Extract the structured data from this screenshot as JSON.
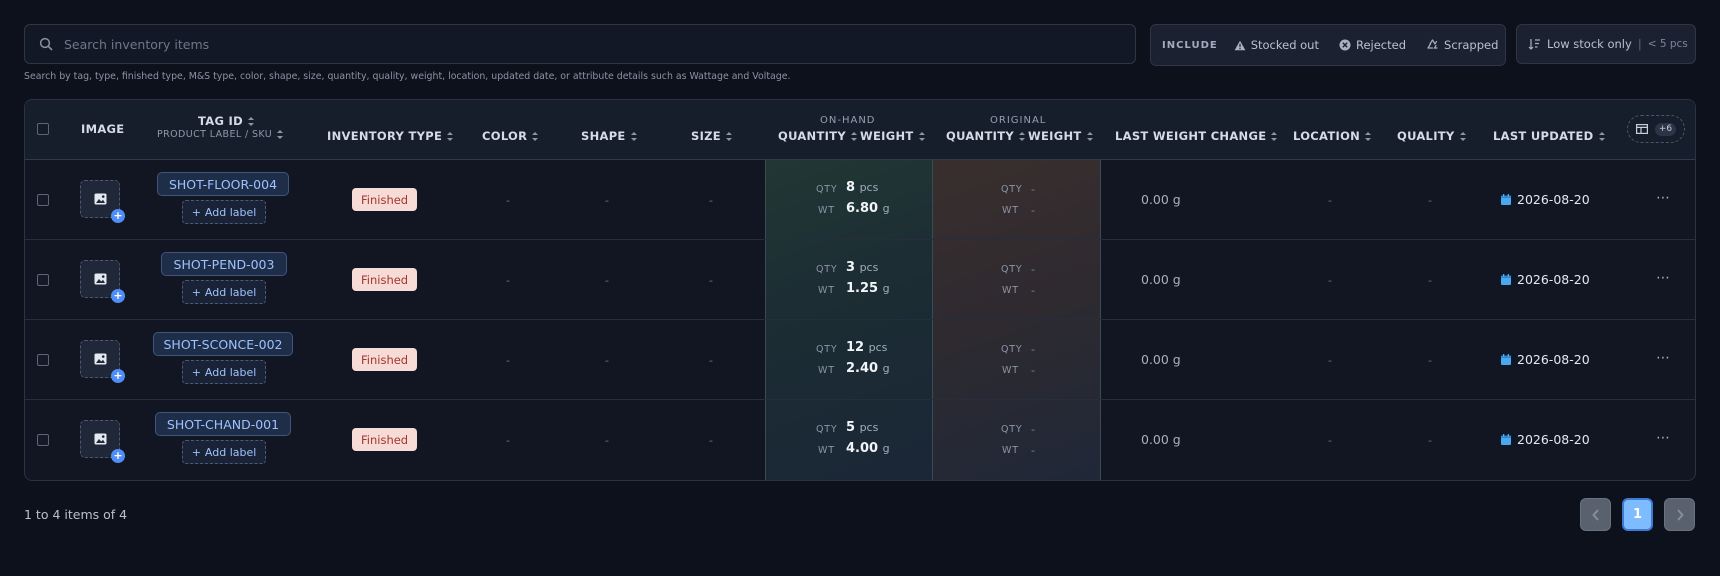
{
  "search": {
    "placeholder": "Search inventory items",
    "hint": "Search by tag, type, finished type, M&S type, color, shape, size, quantity, quality, weight, location, updated date, or attribute details such as Wattage and Voltage."
  },
  "include": {
    "label": "INCLUDE",
    "options": [
      "Stocked out",
      "Rejected",
      "Scrapped"
    ]
  },
  "low_stock": {
    "label": "Low stock only",
    "detail": "< 5 pcs"
  },
  "table": {
    "headers": {
      "image": "IMAGE",
      "tag_id": "TAG ID",
      "tag_sub": "PRODUCT LABEL / SKU",
      "inventory_type": "INVENTORY TYPE",
      "color": "COLOR",
      "shape": "SHAPE",
      "size": "SIZE",
      "on_hand": "ON-HAND",
      "original": "ORIGINAL",
      "quantity": "QUANTITY",
      "weight": "WEIGHT",
      "last_weight_change": "LAST WEIGHT CHANGE",
      "location": "LOCATION",
      "quality": "QUALITY",
      "last_updated": "LAST UPDATED",
      "more_columns": "+6"
    },
    "labels": {
      "qty": "QTY",
      "wt": "WT",
      "pcs": "pcs",
      "g": "g",
      "add_label": "Add label",
      "dash": "-"
    },
    "rows": [
      {
        "tag": "SHOT-FLOOR-004",
        "type": "Finished",
        "color": "-",
        "shape": "-",
        "size": "-",
        "qty": "8",
        "wt": "6.80",
        "orig_qty": "-",
        "orig_wt": "-",
        "last_change": "0.00 g",
        "location": "-",
        "quality": "-",
        "updated": "2026-08-20"
      },
      {
        "tag": "SHOT-PEND-003",
        "type": "Finished",
        "color": "-",
        "shape": "-",
        "size": "-",
        "qty": "3",
        "wt": "1.25",
        "orig_qty": "-",
        "orig_wt": "-",
        "last_change": "0.00 g",
        "location": "-",
        "quality": "-",
        "updated": "2026-08-20"
      },
      {
        "tag": "SHOT-SCONCE-002",
        "type": "Finished",
        "color": "-",
        "shape": "-",
        "size": "-",
        "qty": "12",
        "wt": "2.40",
        "orig_qty": "-",
        "orig_wt": "-",
        "last_change": "0.00 g",
        "location": "-",
        "quality": "-",
        "updated": "2026-08-20"
      },
      {
        "tag": "SHOT-CHAND-001",
        "type": "Finished",
        "color": "-",
        "shape": "-",
        "size": "-",
        "qty": "5",
        "wt": "4.00",
        "orig_qty": "-",
        "orig_wt": "-",
        "last_change": "0.00 g",
        "location": "-",
        "quality": "-",
        "updated": "2026-08-20"
      }
    ]
  },
  "footer": {
    "summary": "1 to 4 items of 4",
    "page": "1"
  },
  "colors": {
    "accent": "#4f8ef7",
    "badge_bg": "#f7dbd6",
    "badge_text": "#a3372c",
    "page_active": "#7fbcff"
  }
}
